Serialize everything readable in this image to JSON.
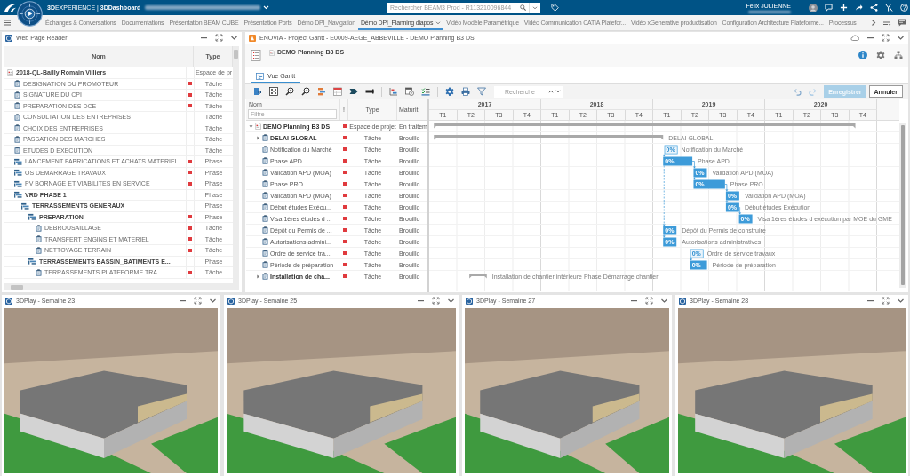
{
  "top_bar": {
    "brand": "**3D**EXPERIENCE | **3DDashboard**",
    "search": {
      "placeholder": "Rechercher BEAM3 Prod - R113210096844"
    },
    "user_name": "Félix JULIENNE"
  },
  "tabs": [
    {
      "label": "Échanges & Conversations",
      "selected": false
    },
    {
      "label": "Documentations",
      "selected": false
    },
    {
      "label": "Présentation BEAM CUBE",
      "selected": false
    },
    {
      "label": "Présentation Ports",
      "selected": false
    },
    {
      "label": "Démo DPI_Navigation",
      "selected": false
    },
    {
      "label": "Démo DPI_Planning diapos",
      "selected": true
    },
    {
      "label": "Vidéo Modèle Paramétrique",
      "selected": false
    },
    {
      "label": "Vidéo Communication CATIA Platefor...",
      "selected": false
    },
    {
      "label": "Vidéo xGenerative productisation",
      "selected": false
    },
    {
      "label": "Configuration Architecture Plateforme...",
      "selected": false
    },
    {
      "label": "Processus",
      "selected": false
    }
  ],
  "left_panel": {
    "title": "Web Page Reader",
    "columns": [
      "Nom",
      "Type"
    ],
    "rows": [
      {
        "name": "2018-QL-Bailly Romain Villiers",
        "kind": "project",
        "flagged": false,
        "type": "Espace de pr",
        "children": [
          {
            "name": "DESIGNATION DU PROMOTEUR",
            "kind": "task",
            "flagged": true,
            "type": "Tâche"
          },
          {
            "name": "SIGNATURE DU CPI",
            "kind": "task",
            "flagged": true,
            "type": "Tâche"
          },
          {
            "name": "PREPARATION DES DCE",
            "kind": "task",
            "flagged": true,
            "type": "Tâche"
          },
          {
            "name": "CONSULTATION DES ENTREPRISES",
            "kind": "task",
            "flagged": false,
            "type": "Tâche"
          },
          {
            "name": "CHOIX DES ENTREPRISES",
            "kind": "task",
            "flagged": false,
            "type": "Tâche"
          },
          {
            "name": "PASSATION DES MARCHES",
            "kind": "task",
            "flagged": false,
            "type": "Tâche"
          },
          {
            "name": "ETUDES D EXECUTION",
            "kind": "task",
            "flagged": false,
            "type": "Tâche"
          },
          {
            "name": "LANCEMENT FABRICATIONS ET ACHATS MATERIEL",
            "kind": "phase",
            "flagged": true,
            "type": "Phase"
          },
          {
            "name": "OS DEMARRAGE TRAVAUX",
            "kind": "phase",
            "flagged": true,
            "type": "Phase"
          },
          {
            "name": "PV BORNAGE ET VIABILITES EN SERVICE",
            "kind": "phase",
            "flagged": true,
            "type": "Phase"
          },
          {
            "name": "VRD PHASE 1",
            "kind": "phase",
            "flagged": false,
            "type": "Phase",
            "children": [
              {
                "name": "TERRASSEMENTS GENERAUX",
                "kind": "phase",
                "flagged": false,
                "type": "Phase",
                "children": [
                  {
                    "name": "PREPARATION",
                    "kind": "phase",
                    "flagged": true,
                    "type": "Phase",
                    "children": [
                      {
                        "name": "DEBROUSAILLAGE",
                        "kind": "task",
                        "flagged": true,
                        "type": "Tâche"
                      },
                      {
                        "name": "TRANSFERT ENGINS ET MATERIEL",
                        "kind": "task",
                        "flagged": true,
                        "type": "Tâche"
                      },
                      {
                        "name": "NETTOYAGE TERRAIN",
                        "kind": "task",
                        "flagged": true,
                        "type": "Tâche"
                      }
                    ]
                  },
                  {
                    "name": "TERRASSEMENTS BASSIN_BATIMENTS E...",
                    "kind": "phase",
                    "flagged": false,
                    "type": "Phase",
                    "children": [
                      {
                        "name": "TERRASSEMENTS PLATEFORME TRA",
                        "kind": "task",
                        "flagged": true,
                        "type": "Tâche"
                      }
                    ]
                  }
                ]
              }
            ]
          }
        ]
      }
    ]
  },
  "gantt_panel": {
    "title": "ENOVIA - Project Gantt - E0009-AEGE_ABBEVILLE - DEMO Planning B3 DS",
    "object_title": "DEMO Planning B3 DS",
    "view_tabs": [
      {
        "label": "Vue Gantt",
        "selected": true
      }
    ],
    "search": {
      "placeholder": "Recherche"
    },
    "buttons": [
      {
        "label": "Enregistrer",
        "disabled": true
      },
      {
        "label": "Annuler",
        "disabled": false
      }
    ],
    "columns": [
      {
        "label": "Nom",
        "filter_placeholder": "Filtre"
      },
      {
        "label": "!"
      },
      {
        "label": "Type"
      },
      {
        "label": "Maturit"
      }
    ],
    "timeline": {
      "years": [
        {
          "label": "2017",
          "quarters": [
            "T1",
            "T2",
            "T3",
            "T4"
          ]
        },
        {
          "label": "2018",
          "quarters": [
            "T1",
            "T2",
            "T3",
            "T4"
          ]
        },
        {
          "label": "2019",
          "quarters": [
            "T1",
            "T2",
            "T3",
            "T4"
          ]
        },
        {
          "label": "2020",
          "quarters": [
            "T1",
            "T2",
            "T3",
            "T4"
          ]
        }
      ]
    },
    "rows": [
      {
        "name": "DEMO Planning B3 DS",
        "kind": "project",
        "expanded": true,
        "flagged": true,
        "type": "Espace de projet",
        "maturity": "En traitem",
        "bar": {
          "kind": "summary",
          "linked": false
        },
        "children": [
          {
            "name": "DELAI GLOBAL",
            "kind": "task",
            "expanded": false,
            "flagged": true,
            "type": "Tâche",
            "maturity": "Brouillo",
            "bar": {
              "kind": "summary",
              "label": "DELAI GLOBAL",
              "linked": false
            }
          },
          {
            "name": "Notification du Marché",
            "kind": "task",
            "flagged": true,
            "type": "Tâche",
            "maturity": "Brouillo",
            "bar": {
              "kind": "milestone",
              "progress": "0%",
              "label": "Notification du Marché",
              "linked": false
            }
          },
          {
            "name": "Phase APD",
            "kind": "task",
            "flagged": true,
            "type": "Tâche",
            "maturity": "Brouillo",
            "bar": {
              "kind": "task",
              "progress": "0%",
              "label": "Phase APD",
              "linked": true
            }
          },
          {
            "name": "Validation APD (MOA)",
            "kind": "task",
            "flagged": true,
            "type": "Tâche",
            "maturity": "Brouillo",
            "bar": {
              "kind": "task",
              "progress": "0%",
              "label": "Validation APD (MOA)",
              "linked": true
            }
          },
          {
            "name": "Phase PRO",
            "kind": "task",
            "flagged": true,
            "type": "Tâche",
            "maturity": "Brouillo",
            "bar": {
              "kind": "task",
              "progress": "0%",
              "label": "Phase PRO",
              "linked": true
            }
          },
          {
            "name": "Validation APD (MOA)",
            "kind": "task",
            "flagged": true,
            "type": "Tâche",
            "maturity": "Brouillo",
            "bar": {
              "kind": "task",
              "progress": "0%",
              "label": "Validation APD (MOA)",
              "linked": true
            }
          },
          {
            "name": "Début études Exécu...",
            "kind": "task",
            "flagged": true,
            "type": "Tâche",
            "maturity": "Brouillo",
            "bar": {
              "kind": "task",
              "progress": "0%",
              "label": "Début études Exécution",
              "linked": true
            }
          },
          {
            "name": "Visa 1ères études d ...",
            "kind": "task",
            "flagged": true,
            "type": "Tâche",
            "maturity": "Brouillo",
            "bar": {
              "kind": "task",
              "progress": "0%",
              "label": "Visa 1ères études d exécution par MOE du GME",
              "linked": true
            }
          },
          {
            "name": "Dépôt du Permis de ...",
            "kind": "task",
            "flagged": true,
            "type": "Tâche",
            "maturity": "Brouillo",
            "bar": {
              "kind": "task",
              "progress": "0%",
              "label": "Dépôt du Permis de construire",
              "linked": true
            }
          },
          {
            "name": "Autorisations admini...",
            "kind": "task",
            "flagged": true,
            "type": "Tâche",
            "maturity": "Brouillo",
            "bar": {
              "kind": "task",
              "progress": "0%",
              "label": "Autorisations administratives",
              "linked": true
            }
          },
          {
            "name": "Ordre de service tra...",
            "kind": "task",
            "flagged": true,
            "type": "Tâche",
            "maturity": "Brouillo",
            "bar": {
              "kind": "milestone",
              "progress": "0%",
              "label": "Ordre de service travaux",
              "linked": false
            }
          },
          {
            "name": "Période de préparation",
            "kind": "task",
            "flagged": true,
            "type": "Tâche",
            "maturity": "Brouillo",
            "bar": {
              "kind": "task",
              "progress": "0%",
              "label": "Période de préparation",
              "linked": true
            }
          },
          {
            "name": "Installation de cha...",
            "kind": "task",
            "expanded": false,
            "flagged": true,
            "type": "Tâche",
            "maturity": "Brouillo",
            "bar": {
              "kind": "summary",
              "label": "Installation de chantier intérieure Phase Démarrage chantier",
              "linked": false
            }
          }
        ]
      }
    ]
  },
  "play_panels": [
    {
      "title": "3DPlay - Semaine 23"
    },
    {
      "title": "3DPlay - Semaine 25"
    },
    {
      "title": "3DPlay - Semaine 27"
    },
    {
      "title": "3DPlay - Semaine 28"
    }
  ]
}
